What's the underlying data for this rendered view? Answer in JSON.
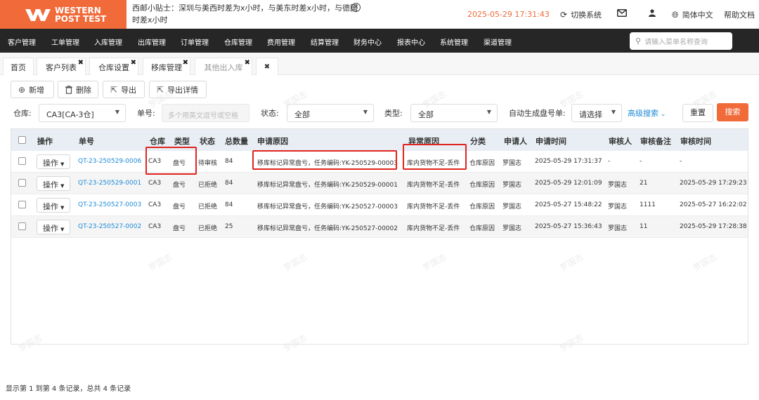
{
  "header": {
    "logo_line1": "WESTERN",
    "logo_line2_a": "POST",
    "logo_line2_b": "TEST",
    "tip_text": "西邮小贴士：深圳与美西时差为x小时，与美东时差x小时，与德国时差x小时",
    "datetime": "2025-05-29 17:31:43",
    "switch_system": "切换系统",
    "language": "简体中文",
    "help": "帮助文档"
  },
  "nav": {
    "items": [
      "客户管理",
      "工单管理",
      "入库管理",
      "出库管理",
      "订单管理",
      "仓库管理",
      "费用管理",
      "结算管理",
      "财务中心",
      "报表中心",
      "系统管理",
      "渠道管理"
    ],
    "search_placeholder": "请输入菜单名称查询"
  },
  "tabs": [
    {
      "label": "首页",
      "closable": false
    },
    {
      "label": "客户列表",
      "closable": true
    },
    {
      "label": "仓库设置",
      "closable": true
    },
    {
      "label": "移库管理",
      "closable": true
    },
    {
      "label": "其他出入库",
      "closable": true,
      "active": true
    },
    {
      "label": "",
      "closable": true
    }
  ],
  "toolbar": {
    "add": "新增",
    "delete": "删除",
    "export": "导出",
    "export_detail": "导出详情"
  },
  "filters": {
    "warehouse_label": "仓库:",
    "warehouse_value": "CA3[CA-3仓]",
    "order_label": "单号:",
    "order_placeholder": "多个用英文逗号或空格",
    "status_label": "状态:",
    "status_value": "全部",
    "type_label": "类型:",
    "type_value": "全部",
    "auto_label": "自动生成盘号单:",
    "auto_value": "请选择",
    "advanced": "高级搜索",
    "reset": "重置",
    "search": "搜索"
  },
  "table": {
    "headers": [
      "操作",
      "单号",
      "仓库",
      "类型",
      "状态",
      "总数量",
      "申请原因",
      "异常原因",
      "分类",
      "申请人",
      "申请时间",
      "审核人",
      "审核备注",
      "审核时间"
    ],
    "op_label": "操作",
    "rows": [
      {
        "order": "QT-23-250529-0006",
        "warehouse": "CA3",
        "type": "盘亏",
        "status": "待审核",
        "qty": "84",
        "reason": "移库标记异常盘亏，任务编码:YK-250529-00003",
        "abnormal": "库内货物不足-丢件",
        "category": "仓库原因",
        "applicant": "罗国志",
        "apply_time": "2025-05-29 17:31:37",
        "auditor": "-",
        "audit_note": "-",
        "audit_time": "-"
      },
      {
        "order": "QT-23-250529-0001",
        "warehouse": "CA3",
        "type": "盘亏",
        "status": "已拒绝",
        "qty": "84",
        "reason": "移库标记异常盘亏，任务编码:YK-250529-00001",
        "abnormal": "库内货物不足-丢件",
        "category": "仓库原因",
        "applicant": "罗国志",
        "apply_time": "2025-05-29 12:01:09",
        "auditor": "罗国志",
        "audit_note": "21",
        "audit_time": "2025-05-29 17:29:23"
      },
      {
        "order": "QT-23-250527-0003",
        "warehouse": "CA3",
        "type": "盘亏",
        "status": "已拒绝",
        "qty": "84",
        "reason": "移库标记异常盘亏，任务编码:YK-250527-00003",
        "abnormal": "库内货物不足-丢件",
        "category": "仓库原因",
        "applicant": "罗国志",
        "apply_time": "2025-05-27 15:48:22",
        "auditor": "罗国志",
        "audit_note": "1111",
        "audit_time": "2025-05-27 16:22:02"
      },
      {
        "order": "QT-23-250527-0002",
        "warehouse": "CA3",
        "type": "盘亏",
        "status": "已拒绝",
        "qty": "25",
        "reason": "移库标记异常盘亏，任务编码:YK-250527-00002",
        "abnormal": "库内货物不足-丢件",
        "category": "仓库原因",
        "applicant": "罗国志",
        "apply_time": "2025-05-27 15:36:43",
        "auditor": "罗国志",
        "audit_note": "11",
        "audit_time": "2025-05-29 17:28:38"
      }
    ]
  },
  "footer": {
    "summary": "显示第 1 到第 4 条记录，总共 4 条记录"
  },
  "watermark": "罗国志",
  "colors": {
    "brand": "#f06a3a",
    "nav_bg": "#262626",
    "link": "#1e8bd6",
    "highlight_box": "#e0241f"
  }
}
